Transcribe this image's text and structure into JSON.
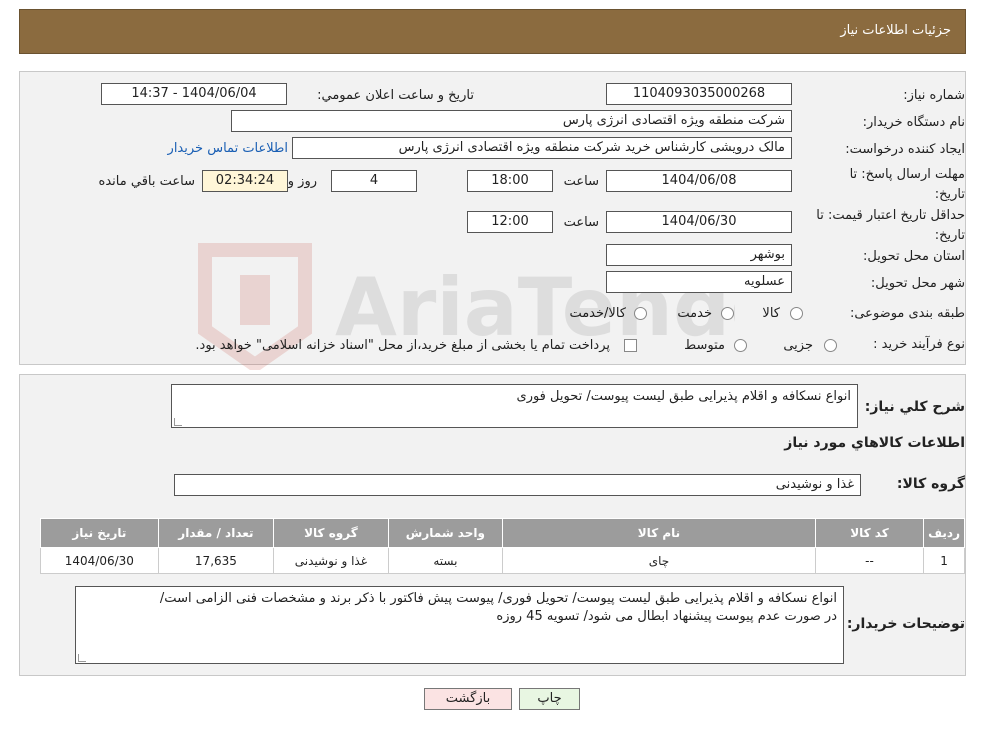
{
  "header": {
    "title": "جزئیات اطلاعات نیاز"
  },
  "form": {
    "need_number_label": "شماره نیاز:",
    "need_number": "1104093035000268",
    "announce_label": "تاریخ و ساعت اعلان عمومي:",
    "announce_value": "1404/06/04 - 14:37",
    "buyer_org_label": "نام دستگاه خریدار:",
    "buyer_org": "شرکت منطقه ویژه اقتصادی انرژی پارس",
    "requester_label": "ایجاد کننده درخواست:",
    "requester": "مالک  درویشی کارشناس خرید شرکت منطقه ویژه اقتصادی انرژی پارس",
    "contact_link": "اطلاعات تماس خریدار",
    "deadline_label": "مهلت ارسال پاسخ: تا تاریخ:",
    "deadline_date": "1404/06/08",
    "time_label": "ساعت",
    "deadline_time": "18:00",
    "days_value": "4",
    "days_label": "روز و",
    "remaining_value": "02:34:24",
    "remaining_label": "ساعت باقي مانده",
    "validity_label": "حداقل تاریخ اعتبار قیمت: تا تاریخ:",
    "validity_date": "1404/06/30",
    "validity_time": "12:00",
    "province_label": "استان محل تحویل:",
    "province": "بوشهر",
    "city_label": "شهر محل تحویل:",
    "city": "عسلویه",
    "category_label": "طبقه بندی موضوعی:",
    "category_options": [
      "کالا",
      "خدمت",
      "کالا/خدمت"
    ],
    "process_label": "نوع فرآیند خرید :",
    "process_options": [
      "جزیی",
      "متوسط"
    ],
    "payment_note": "پرداخت تمام یا بخشی از مبلغ خرید،از محل \"اسناد خزانه اسلامی\" خواهد بود."
  },
  "description": {
    "label": "شرح کلي نیاز:",
    "value": "انواع نسکافه و اقلام پذیرایی طبق لیست پیوست/ تحویل فوری"
  },
  "goods": {
    "section_title": "اطلاعات کالاهاي مورد نیاز",
    "group_label": "گروه کالا:",
    "group_value": "غذا و نوشیدنی",
    "columns": [
      "ردیف",
      "کد کالا",
      "نام کالا",
      "واحد شمارش",
      "گروه کالا",
      "تعداد / مقدار",
      "تاریخ نیاز"
    ],
    "rows": [
      [
        "1",
        "--",
        "چای",
        "بسته",
        "غذا و نوشیدنی",
        "17,635",
        "1404/06/30"
      ]
    ]
  },
  "buyer_notes": {
    "label": "توضیحات خریدار:",
    "line1": "انواع نسکافه و اقلام پذیرایی طبق لیست پیوست/ تحویل فوری/ پیوست پیش فاکتور با ذکر برند و مشخصات فنی الزامی است/",
    "line2": "در صورت عدم پیوست پیشنهاد ابطال می شود/ تسویه 45 روزه"
  },
  "buttons": {
    "print": "چاپ",
    "back": "بازگشت"
  },
  "colors": {
    "header": "#8b6b3f",
    "table_header": "#9c9c9c",
    "back_button": "#fbe3e3",
    "print_button": "#e8f6e2",
    "link": "#1a5fb4"
  }
}
